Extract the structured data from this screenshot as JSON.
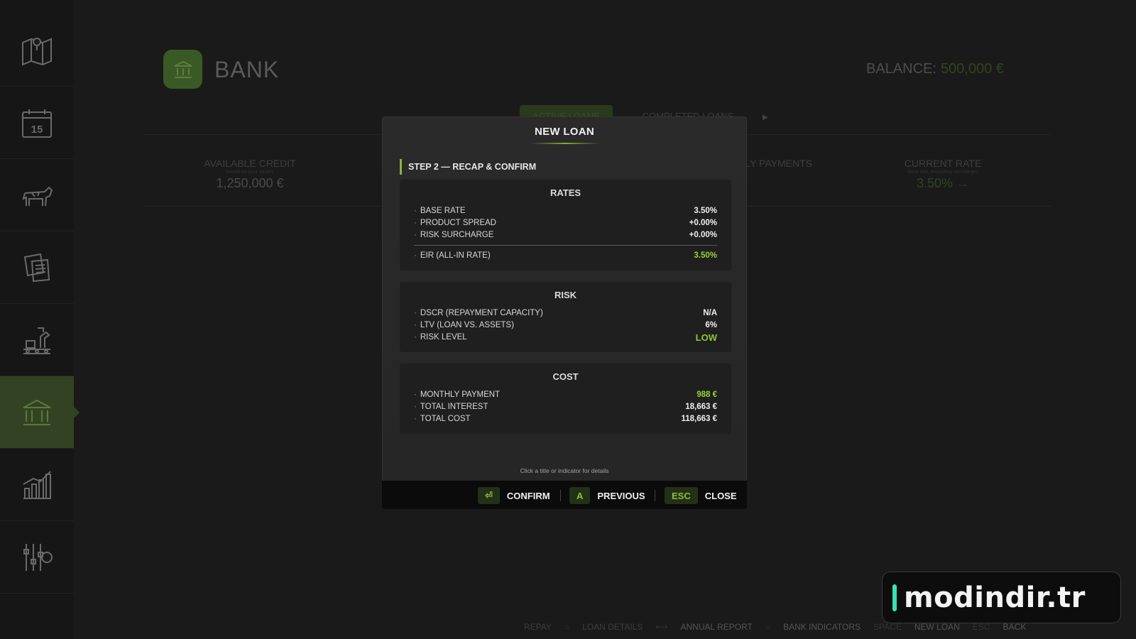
{
  "sidebar": {
    "items": [
      {
        "name": "map-icon"
      },
      {
        "name": "calendar-icon",
        "text": "15"
      },
      {
        "name": "cow-icon"
      },
      {
        "name": "contracts-icon"
      },
      {
        "name": "production-icon"
      },
      {
        "name": "bank-icon",
        "active": true
      },
      {
        "name": "statistics-icon"
      },
      {
        "name": "settings-icon"
      }
    ]
  },
  "page": {
    "title": "BANK",
    "balance_label": "BALANCE:",
    "balance_value": "500,000 €",
    "tabs": [
      "ACTIVE LOANS",
      "COMPLETED LOANS"
    ],
    "kpis": [
      {
        "label": "AVAILABLE CREDIT",
        "sub": "based on your assets",
        "value": "1,250,000 €"
      },
      {
        "label": "MONTHLY PAYMENTS",
        "sub": "",
        "value": ""
      },
      {
        "label": "CURRENT RATE",
        "sub": "base rate, excluding surcharges",
        "value": "3.50% →"
      }
    ]
  },
  "bottom_hints": [
    {
      "key": "",
      "label": "REPAY"
    },
    {
      "key": "",
      "label": "LOAN DETAILS"
    },
    {
      "key": "",
      "label": "ANNUAL REPORT"
    },
    {
      "key": "",
      "label": "BANK INDICATORS"
    },
    {
      "key": "SPACE",
      "label": "NEW LOAN"
    },
    {
      "key": "ESC",
      "label": "BACK"
    }
  ],
  "modal": {
    "title": "NEW LOAN",
    "step": "STEP 2 — RECAP & CONFIRM",
    "rates": {
      "title": "RATES",
      "rows": [
        {
          "label": "BASE RATE",
          "value": "3.50%"
        },
        {
          "label": "PRODUCT SPREAD",
          "value": "+0.00%"
        },
        {
          "label": "RISK SURCHARGE",
          "value": "+0.00%"
        }
      ],
      "eir_label": "EIR (ALL-IN RATE)",
      "eir_value": "3.50%"
    },
    "risk": {
      "title": "RISK",
      "rows": [
        {
          "label": "DSCR (REPAYMENT CAPACITY)",
          "value": "N/A"
        },
        {
          "label": "LTV (LOAN VS. ASSETS)",
          "value": "6%"
        },
        {
          "label": "RISK LEVEL",
          "value": "LOW"
        }
      ]
    },
    "cost": {
      "title": "COST",
      "rows": [
        {
          "label": "MONTHLY PAYMENT",
          "value": "988 €"
        },
        {
          "label": "TOTAL INTEREST",
          "value": "18,663 €"
        },
        {
          "label": "TOTAL COST",
          "value": "118,663 €"
        }
      ]
    },
    "hint": "Click a title or indicator for details",
    "actions": [
      {
        "key": "⏎",
        "label": "CONFIRM"
      },
      {
        "key": "A",
        "label": "PREVIOUS"
      },
      {
        "key": "ESC",
        "label": "CLOSE"
      }
    ]
  },
  "watermark": {
    "text": "modindir.tr"
  },
  "colors": {
    "accent": "#8fc73a",
    "background": "#1a1a1a",
    "modal": "#2a2a2a",
    "card": "#1f1f1f"
  }
}
